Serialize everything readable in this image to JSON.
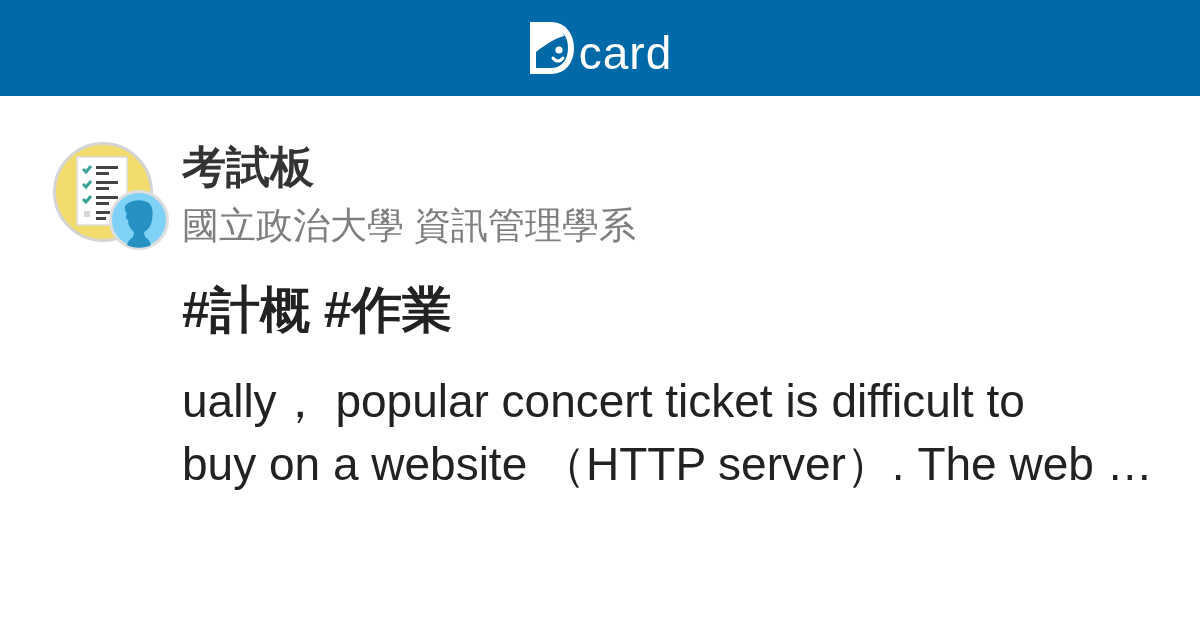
{
  "header": {
    "logo_text": "card"
  },
  "board": {
    "name": "考試板",
    "school": "國立政治大學 資訊管理學系"
  },
  "post": {
    "title": "#計概 #作業",
    "excerpt": "ually， popular concert ticket is difficult to\nbuy on a website （HTTP server）. The web …"
  }
}
